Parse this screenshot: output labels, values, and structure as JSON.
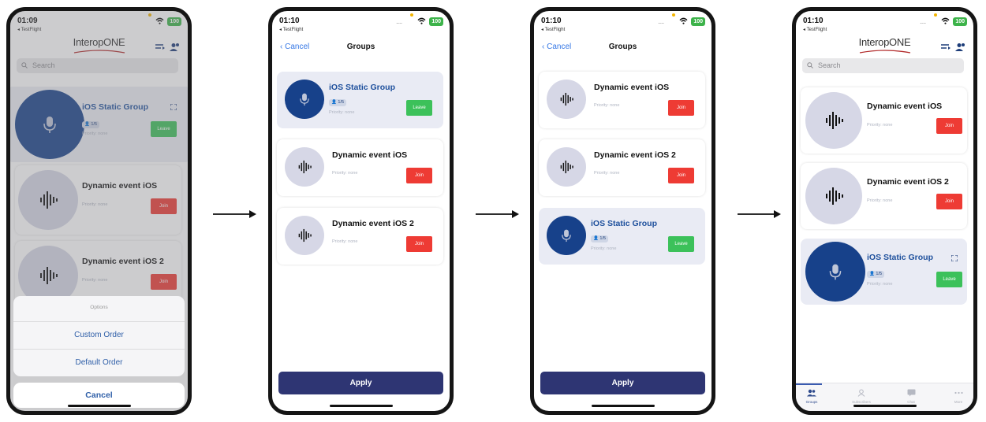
{
  "common": {
    "testflight": "◂ TestFlight",
    "battery": "100",
    "signal": "....",
    "logo": "InteropONE",
    "search_placeholder": "Search",
    "cancel_nav": "Cancel",
    "groups_title": "Groups",
    "apply": "Apply",
    "priority": "Priority: none",
    "badge_count": "1/5",
    "join": "Join",
    "leave": "Leave"
  },
  "screens": [
    {
      "time": "01:09",
      "groups": [
        {
          "name": "iOS Static Group",
          "action": "Leave",
          "active": true
        },
        {
          "name": "Dynamic event iOS",
          "action": "Join",
          "active": false
        },
        {
          "name": "Dynamic event iOS 2",
          "action": "Join",
          "active": false
        }
      ],
      "action_sheet": {
        "title": "Options",
        "options": [
          "Custom Order",
          "Default Order"
        ],
        "cancel": "Cancel"
      }
    },
    {
      "time": "01:10",
      "groups": [
        {
          "name": "iOS Static Group",
          "action": "Leave",
          "active": true
        },
        {
          "name": "Dynamic event iOS",
          "action": "Join",
          "active": false
        },
        {
          "name": "Dynamic event iOS 2",
          "action": "Join",
          "active": false
        }
      ]
    },
    {
      "time": "01:10",
      "groups": [
        {
          "name": "Dynamic event iOS",
          "action": "Join",
          "active": false
        },
        {
          "name": "Dynamic event iOS 2",
          "action": "Join",
          "active": false
        },
        {
          "name": "iOS Static Group",
          "action": "Leave",
          "active": true
        }
      ]
    },
    {
      "time": "01:10",
      "groups": [
        {
          "name": "Dynamic event iOS",
          "action": "Join",
          "active": false
        },
        {
          "name": "Dynamic event iOS 2",
          "action": "Join",
          "active": false
        },
        {
          "name": "iOS Static Group",
          "action": "Leave",
          "active": true
        }
      ],
      "tabs": [
        {
          "label": "Groups",
          "icon": "groups-icon",
          "active": true
        },
        {
          "label": "Subscribers",
          "icon": "subscribers-icon",
          "active": false
        },
        {
          "label": "Chat",
          "icon": "chat-icon",
          "active": false
        },
        {
          "label": "More",
          "icon": "more-icon",
          "active": false
        }
      ]
    }
  ],
  "colors": {
    "accent_blue": "#17418a",
    "join_red": "#ee3b34",
    "leave_green": "#3cc15a",
    "apply_navy": "#2e3573",
    "link_blue": "#3577e5"
  }
}
